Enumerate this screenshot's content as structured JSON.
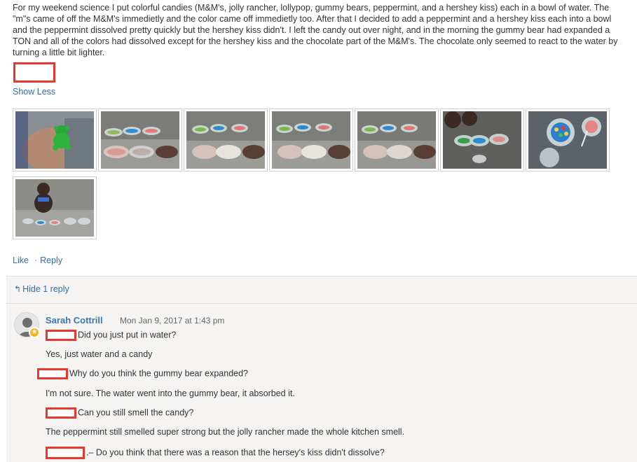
{
  "post": {
    "text": "For my weekend science I put colorful candies (M&M's, jolly rancher, lollypop, gummy bears, peppermint, and a hershey kiss) each in a bowl of water. The \"m\"s came of off the M&M's immedietly and the color came off immedietly too. After that I decided to add a peppermint and a hershey kiss each into a bowl and the peppermint dissolved pretty quickly but the hershey kiss didn't. I left the candy out over night, and in the morning the gummy bear had expanded a TON and all of the colors had dissolved except for the hershey kiss and the chocolate part of the M&M's. The chocolate only seemed to react to the water by turning a little bit lighter.",
    "show_less": "Show Less",
    "like": "Like",
    "reply": "Reply",
    "separator": "·"
  },
  "thumbnails": [
    {
      "subject": "gummy-bear-in-hand"
    },
    {
      "subject": "candy-bowls-1"
    },
    {
      "subject": "candy-bowls-2"
    },
    {
      "subject": "candy-bowls-3"
    },
    {
      "subject": "candy-bowls-4"
    },
    {
      "subject": "candy-bowls-5"
    },
    {
      "subject": "candy-bowl-closeup"
    },
    {
      "subject": "teddy-bear-with-bowls"
    }
  ],
  "replies": {
    "toggle_label": "Hide 1 reply",
    "comment": {
      "author": "Sarah Cottrill",
      "timestamp": "Mon Jan 9, 2017 at 1:43 pm",
      "lines": [
        "Did you just put in water?",
        "Yes, just water and a candy",
        "Why do you think the gummy bear expanded?",
        "I'm not sure. The water went into the gummy bear, it absorbed it.",
        "Can you still smell the candy?",
        "The peppermint still smelled super strong but the jolly rancher made the whole kitchen smell.",
        ".– Do you think that there was a reason that the hersey's kiss didn't dissolve?"
      ]
    }
  },
  "colors": {
    "link": "#2f6fa8",
    "redaction": "#e8372e",
    "panel": "#f5f4f2"
  }
}
